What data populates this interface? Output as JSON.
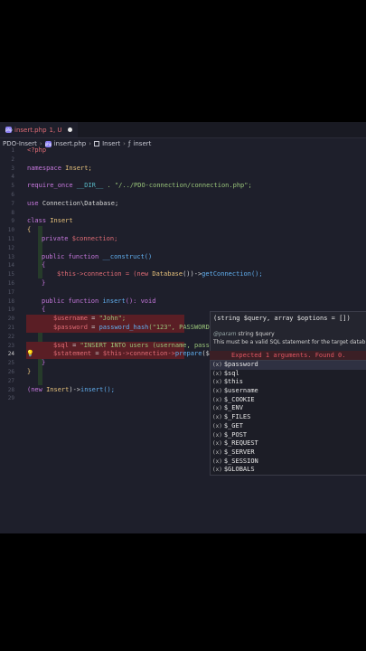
{
  "tab": {
    "icon": "php-file-icon",
    "filename": "insert.php",
    "status": "1, U"
  },
  "breadcrumb": {
    "root": "PDO-Insert",
    "file": "insert.php",
    "namespace": "Insert",
    "function": "insert"
  },
  "lines": [
    {
      "n": "1"
    },
    {
      "n": "2"
    },
    {
      "n": "3"
    },
    {
      "n": "4"
    },
    {
      "n": "5"
    },
    {
      "n": "6"
    },
    {
      "n": "7"
    },
    {
      "n": "8"
    },
    {
      "n": "9"
    },
    {
      "n": "10"
    },
    {
      "n": "11"
    },
    {
      "n": "12"
    },
    {
      "n": "13"
    },
    {
      "n": "14"
    },
    {
      "n": "15"
    },
    {
      "n": "16"
    },
    {
      "n": "17"
    },
    {
      "n": "18"
    },
    {
      "n": "19"
    },
    {
      "n": "20"
    },
    {
      "n": "21"
    },
    {
      "n": "22"
    },
    {
      "n": "23"
    },
    {
      "n": "24"
    },
    {
      "n": "25"
    },
    {
      "n": "26"
    },
    {
      "n": "27"
    },
    {
      "n": "28"
    },
    {
      "n": "29"
    }
  ],
  "code": {
    "l1": "<?php",
    "l3a": "namespace",
    "l3b": "Insert;",
    "l5a": "require_once",
    "l5b": "__DIR__",
    "l5c": ". \"/../PDO-connection/connection.php\";",
    "l7a": "use",
    "l7b": "Connection\\Database;",
    "l9a": "class",
    "l9b": "Insert",
    "l10": "{",
    "l11a": "private",
    "l11b": "$connection;",
    "l13a": "public function",
    "l13b": "__construct()",
    "l14": "{",
    "l15a": "$this",
    "l15b": "->connection = (new",
    "l15c": "Database",
    "l15d": "())->",
    "l15e": "getConnection();",
    "l16": "}",
    "l18a": "public function",
    "l18b": "insert",
    "l18c": "(): void",
    "l19": "{",
    "l20a": "$username",
    "l20b": "= ",
    "l20c": "\"John\";",
    "l21a": "$password",
    "l21b": "= ",
    "l21c": "password_hash",
    "l21d": "(\"123\", PASSWORD",
    "l23a": "$sql",
    "l23b": "= ",
    "l23c": "\"INSERT INTO users (username, pass",
    "l24a": "$statement",
    "l24b": "= ",
    "l24c": "$this",
    "l24d": "->connection->",
    "l24e": "prepare",
    "l24f": "($",
    "l25": "}",
    "l26": "}",
    "l28a": "(new",
    "l28b": "Insert",
    "l28c": ")->",
    "l28d": "insert();"
  },
  "signature_help": {
    "signature": "(string $query, array $options = [])",
    "param_tag": "@param",
    "param_text": "string $query",
    "description": "This must be a valid SQL statement for the target datab"
  },
  "diagnostic": "Expected 1 arguments. Found 0.",
  "suggestions": [
    {
      "kind": "(x)",
      "label": "$password"
    },
    {
      "kind": "(x)",
      "label": "$sql"
    },
    {
      "kind": "(x)",
      "label": "$this"
    },
    {
      "kind": "(x)",
      "label": "$username"
    },
    {
      "kind": "(x)",
      "label": "$_COOKIE"
    },
    {
      "kind": "(x)",
      "label": "$_ENV"
    },
    {
      "kind": "(x)",
      "label": "$_FILES"
    },
    {
      "kind": "(x)",
      "label": "$_GET"
    },
    {
      "kind": "(x)",
      "label": "$_POST"
    },
    {
      "kind": "(x)",
      "label": "$_REQUEST"
    },
    {
      "kind": "(x)",
      "label": "$_SERVER"
    },
    {
      "kind": "(x)",
      "label": "$_SESSION"
    },
    {
      "kind": "(x)",
      "label": "$GLOBALS"
    }
  ]
}
